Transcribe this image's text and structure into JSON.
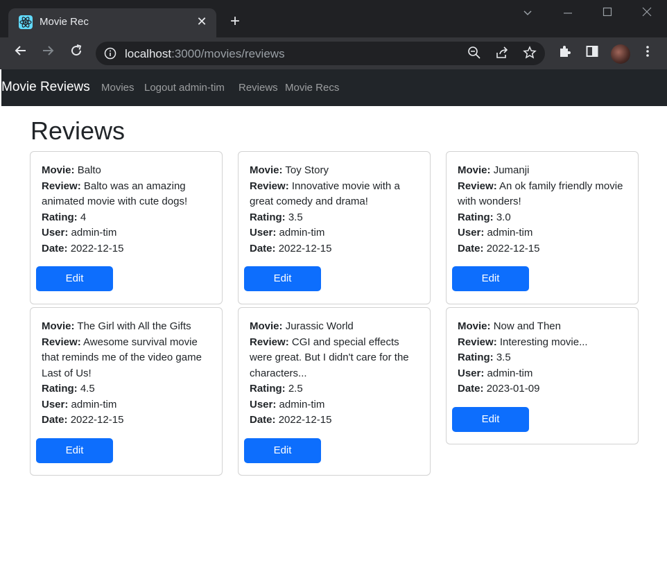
{
  "browser": {
    "tab_title": "Movie Rec",
    "tab_close": "✕",
    "new_tab": "+",
    "url_host": "localhost",
    "url_path": ":3000/movies/reviews"
  },
  "navbar": {
    "brand": "Movie Reviews",
    "links": [
      "Movies",
      "Logout admin-tim",
      "Reviews",
      "Movie Recs"
    ]
  },
  "page": {
    "title": "Reviews"
  },
  "labels": {
    "movie": "Movie:",
    "review": "Review:",
    "rating": "Rating:",
    "user": "User:",
    "date": "Date:",
    "edit": "Edit"
  },
  "reviews": [
    {
      "movie": "Balto",
      "review": "Balto was an amazing animated movie with cute dogs!",
      "rating": "4",
      "user": "admin-tim",
      "date": "2022-12-15"
    },
    {
      "movie": "Toy Story",
      "review": "Innovative movie with a great comedy and drama!",
      "rating": "3.5",
      "user": "admin-tim",
      "date": "2022-12-15"
    },
    {
      "movie": "Jumanji",
      "review": "An ok family friendly movie with wonders!",
      "rating": "3.0",
      "user": "admin-tim",
      "date": "2022-12-15"
    },
    {
      "movie": "The Girl with All the Gifts",
      "review": "Awesome survival movie that reminds me of the video game Last of Us!",
      "rating": "4.5",
      "user": "admin-tim",
      "date": "2022-12-15"
    },
    {
      "movie": "Jurassic World",
      "review": "CGI and special effects were great. But I didn't care for the characters...",
      "rating": "2.5",
      "user": "admin-tim",
      "date": "2022-12-15"
    },
    {
      "movie": "Now and Then",
      "review": "Interesting movie...",
      "rating": "3.5",
      "user": "admin-tim",
      "date": "2023-01-09"
    }
  ]
}
